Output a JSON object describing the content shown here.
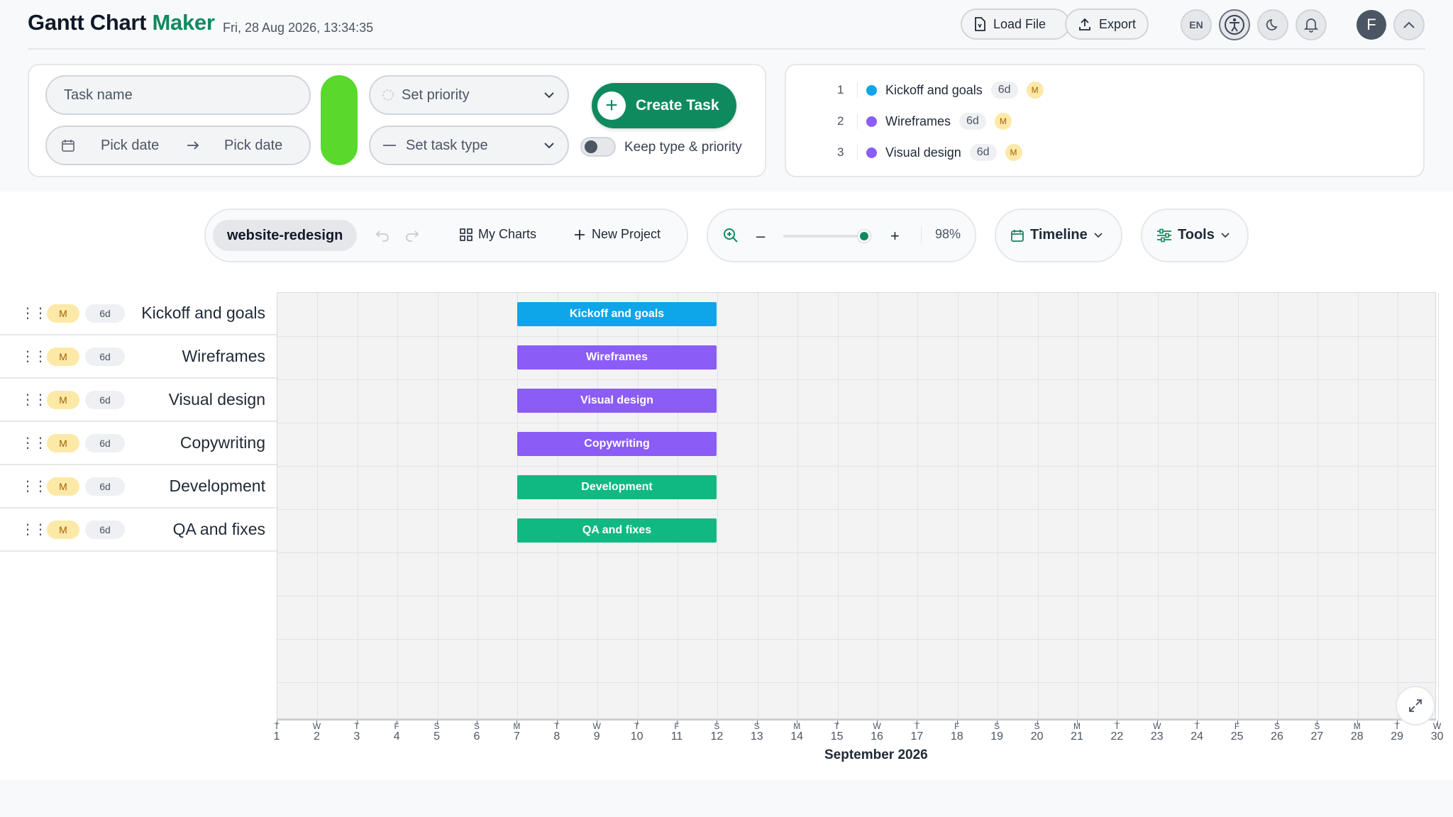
{
  "app": {
    "title_main": "Gantt Chart ",
    "title_accent": "Maker",
    "datetime": "Fri, 28 Aug 2026, 13:34:35"
  },
  "header": {
    "load_label": "Load File",
    "export_label": "Export",
    "lang_label": "EN",
    "avatar_initial": "F"
  },
  "form": {
    "task_placeholder": "Task name",
    "start_date_placeholder": "Pick date",
    "end_date_placeholder": "Pick date",
    "priority_placeholder": "Set priority",
    "type_placeholder": "Set task type",
    "create_label": "Create Task",
    "keep_label": "Keep type & priority",
    "keep_checked": false,
    "task_color": "#58d92b"
  },
  "preview": [
    {
      "num": "1",
      "name": "Kickoff and goals",
      "duration": "6d",
      "priority": "M",
      "color": "#0ea5e9"
    },
    {
      "num": "2",
      "name": "Wireframes",
      "duration": "6d",
      "priority": "M",
      "color": "#8b5cf6"
    },
    {
      "num": "3",
      "name": "Visual design",
      "duration": "6d",
      "priority": "M",
      "color": "#8b5cf6"
    }
  ],
  "toolbar": {
    "project_name": "website-redesign",
    "my_charts_label": "My Charts",
    "new_project_label": "New Project",
    "zoom_minus": "–",
    "zoom_plus": "+",
    "zoom_percent": "98%",
    "zoom_value": 0.98,
    "timeline_label": "Timeline",
    "tools_label": "Tools"
  },
  "tasks": [
    {
      "name": "Kickoff and goals",
      "priority": "M",
      "duration": "6d",
      "color": "#0ea5e9"
    },
    {
      "name": "Wireframes",
      "priority": "M",
      "duration": "6d",
      "color": "#8b5cf6"
    },
    {
      "name": "Visual design",
      "priority": "M",
      "duration": "6d",
      "color": "#8b5cf6"
    },
    {
      "name": "Copywriting",
      "priority": "M",
      "duration": "6d",
      "color": "#8b5cf6"
    },
    {
      "name": "Development",
      "priority": "M",
      "duration": "6d",
      "color": "#10b981"
    },
    {
      "name": "QA and fixes",
      "priority": "M",
      "duration": "6d",
      "color": "#10b981"
    }
  ],
  "timeline": {
    "month_label": "September 2026",
    "days": [
      {
        "day": "T",
        "num": "1"
      },
      {
        "day": "W",
        "num": "2"
      },
      {
        "day": "T",
        "num": "3"
      },
      {
        "day": "F",
        "num": "4"
      },
      {
        "day": "S",
        "num": "5"
      },
      {
        "day": "S",
        "num": "6"
      },
      {
        "day": "M",
        "num": "7"
      },
      {
        "day": "T",
        "num": "8"
      },
      {
        "day": "W",
        "num": "9"
      },
      {
        "day": "T",
        "num": "10"
      },
      {
        "day": "F",
        "num": "11"
      },
      {
        "day": "S",
        "num": "12"
      },
      {
        "day": "S",
        "num": "13"
      },
      {
        "day": "M",
        "num": "14"
      },
      {
        "day": "T",
        "num": "15"
      },
      {
        "day": "W",
        "num": "16"
      },
      {
        "day": "T",
        "num": "17"
      },
      {
        "day": "F",
        "num": "18"
      },
      {
        "day": "S",
        "num": "19"
      },
      {
        "day": "S",
        "num": "20"
      },
      {
        "day": "M",
        "num": "21"
      },
      {
        "day": "T",
        "num": "22"
      },
      {
        "day": "W",
        "num": "23"
      },
      {
        "day": "T",
        "num": "24"
      },
      {
        "day": "F",
        "num": "25"
      },
      {
        "day": "S",
        "num": "26"
      },
      {
        "day": "S",
        "num": "27"
      },
      {
        "day": "M",
        "num": "28"
      },
      {
        "day": "T",
        "num": "29"
      },
      {
        "day": "W",
        "num": "30"
      }
    ]
  },
  "colors": {
    "brand": "#0f8a5f"
  }
}
